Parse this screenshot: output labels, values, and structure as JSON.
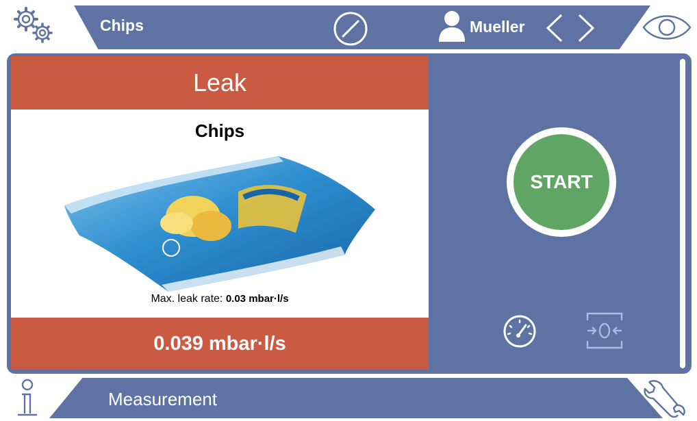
{
  "header": {
    "title": "Chips",
    "user": "Mueller",
    "icons": [
      "settings-icon",
      "compass-icon",
      "user-icon",
      "chevron-left-icon",
      "chevron-right-icon",
      "eye-icon"
    ]
  },
  "result": {
    "status": "Leak",
    "product": "Chips",
    "max_leak_label": "Max. leak rate:",
    "max_leak_value": "0.03 mbar·l/s",
    "measured": "0.039 mbar·l/s"
  },
  "actions": {
    "start_label": "START",
    "icons": [
      "gauge-icon",
      "zero-icon"
    ]
  },
  "footer": {
    "title": "Measurement",
    "icons": [
      "info-icon",
      "wrench-icon"
    ]
  },
  "colors": {
    "bar": "#5e73a3",
    "leak": "#cb5a42",
    "start": "#5fa664"
  }
}
